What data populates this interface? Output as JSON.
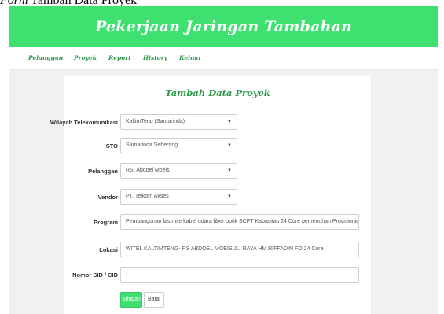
{
  "caption": {
    "prefix": "Form",
    "rest": " Tambah Data Proyek"
  },
  "banner": {
    "title": "Pekerjaan Jaringan Tambahan",
    "color": "#3ee070"
  },
  "nav": {
    "items": [
      "Pelanggan",
      "Proyek",
      "Report",
      "History",
      "Keluar"
    ]
  },
  "form": {
    "title": "Tambah Data Proyek",
    "fields": [
      {
        "label": "Wilayah Telekomunikasi",
        "value": "KaltimTeng (Samarinda)"
      },
      {
        "label": "STO",
        "value": "Samarinda Seberang"
      },
      {
        "label": "Pelanggan",
        "value": "RSI Abdoel Moeis"
      },
      {
        "label": "Vendor",
        "value": "PT. Telkom Akses"
      },
      {
        "label": "Program",
        "value": "Pembangunan lastmile kabel udara fiber optik SCPT Kapasitas 24 Core pemenuhan Provisioning RS Abdoel"
      },
      {
        "label": "Lokasi",
        "value": "WITEL KALTIMTENG- RS ABDOEL MOEIS JL. RAYA HM RIFFADIN FO 24 Core"
      },
      {
        "label": "Nomor SID / CID",
        "value": "-"
      }
    ],
    "save_label": "Simpan",
    "cancel_label": "Batal"
  },
  "icons": {
    "dropdown": "caret-down-icon"
  },
  "colors": {
    "accent": "#3ee070",
    "nav_text": "#2c9a48"
  }
}
